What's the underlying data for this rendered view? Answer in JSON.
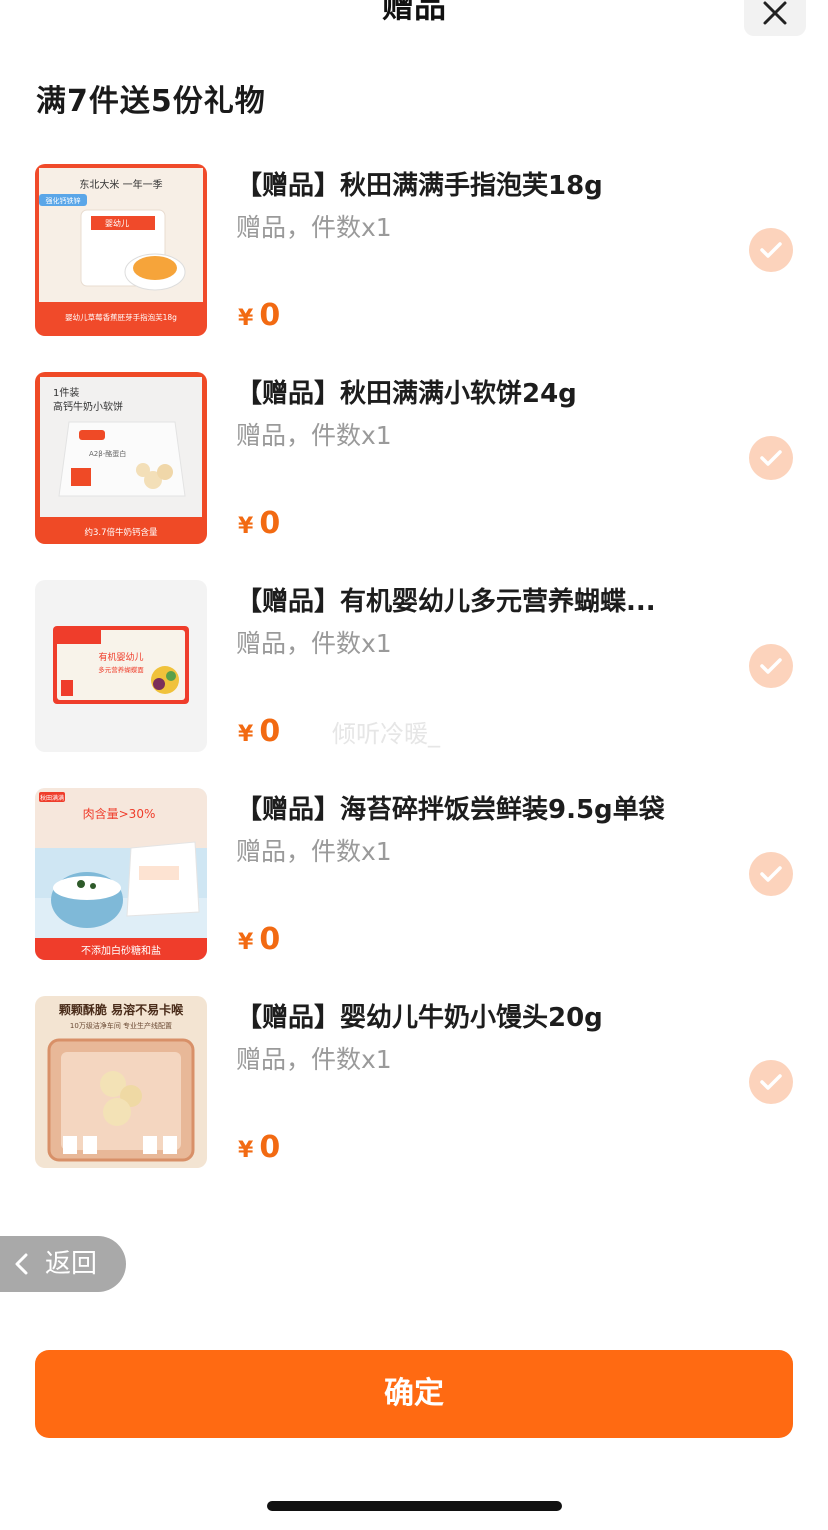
{
  "header": {
    "title": "赠品",
    "close_icon": "close-icon"
  },
  "subtitle": "满7件送5份礼物",
  "gifts": [
    {
      "name": "【赠品】秋田满满手指泡芙18g",
      "meta": "赠品，件数x1",
      "currency": "¥",
      "price": "0",
      "checked": true,
      "thumb_texts": [
        "东北大米 一年一季",
        "强化钙铁锌",
        "婴幼儿",
        "婴幼儿草莓香蕉胚芽手指泡芙18g"
      ]
    },
    {
      "name": "【赠品】秋田满满小软饼24g",
      "meta": "赠品，件数x1",
      "currency": "¥",
      "price": "0",
      "checked": true,
      "thumb_texts": [
        "1件装",
        "高钙牛奶小软饼",
        "A2β-酪蛋白",
        "约3.7倍牛奶钙含量"
      ]
    },
    {
      "name": "【赠品】有机婴幼儿多元营养蝴蝶...",
      "meta": "赠品，件数x1",
      "currency": "¥",
      "price": "0",
      "checked": true,
      "thumb_texts": [
        "有机婴幼儿",
        "多元营养蝴蝶面"
      ]
    },
    {
      "name": "【赠品】海苔碎拌饭尝鲜装9.5g单袋",
      "meta": "赠品，件数x1",
      "currency": "¥",
      "price": "0",
      "checked": true,
      "thumb_texts": [
        "秋田满满",
        "肉含量>30%",
        "不添加白砂糖和盐"
      ]
    },
    {
      "name": "【赠品】婴幼儿牛奶小馒头20g",
      "meta": "赠品，件数x1",
      "currency": "¥",
      "price": "0",
      "checked": true,
      "thumb_texts": [
        "颗颗酥脆 易溶不易卡喉",
        "10万级洁净车间 专业生产线配置"
      ]
    }
  ],
  "watermark": "倾听冷暖_",
  "back_button": {
    "label": "返回"
  },
  "confirm_button": {
    "label": "确定"
  },
  "colors": {
    "accent": "#ff6a12",
    "price": "#f26a12",
    "check_bg": "#fcd3bc",
    "meta_text": "#9a9a9a"
  }
}
